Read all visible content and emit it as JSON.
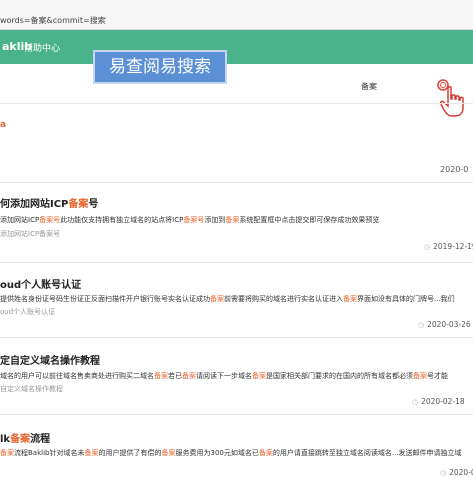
{
  "browser": {
    "url": "words=备案&commit=搜索"
  },
  "header": {
    "logo": "aklib",
    "help_label": "帮助中心"
  },
  "annotation": {
    "label": "易查阅易搜索"
  },
  "search": {
    "value": "备案"
  },
  "section_head": "a",
  "first_result_date": "2020-0",
  "results": [
    {
      "title_pre": "何添加网站ICP",
      "title_hl": "备案",
      "title_post": "号",
      "snippet_parts": [
        "添加网站ICP",
        "备案号",
        "此功能仅支持拥有独立域名的站点将ICP",
        "备案号",
        "添加到",
        "备案",
        "系统配置框中点击提交即可保存成功效果预览"
      ],
      "crumb": "添加网站ICP备案号",
      "date": "2019-12-19"
    },
    {
      "title_pre": "oud个人账号认证",
      "title_hl": "",
      "title_post": "",
      "snippet_parts": [
        "提供姓名身份证号码生份证正反面扫描件开户银行账号实名认证成功",
        "备案",
        "前需要将购买的域名进行实名认证进入",
        "备案",
        "界面如没有具体的门牌号...我们"
      ],
      "crumb": "oud个人账号认证",
      "date": "2020-03-26"
    },
    {
      "title_pre": "定自定义域名操作教程",
      "title_hl": "",
      "title_post": "",
      "snippet_parts": [
        "域名的用户可以前往域名售卖商处进行购买二域名",
        "备案",
        "若已",
        "备案",
        "请阅读下一步域名",
        "备案",
        "是国家相关部门要求的在国内的所有域名都必须",
        "备案",
        "号才能"
      ],
      "crumb": "自定义域名操作教程",
      "date": "2020-02-18"
    },
    {
      "title_pre": "lk",
      "title_hl": "备案",
      "title_post": "流程",
      "snippet_parts": [
        "备案",
        "流程Baklib针对域名未",
        "备案",
        "的用户提供了有偿的",
        "备案",
        "服务费用为300元如域名已",
        "备案",
        "的用户请直接跳转至独立域名阅读域名...发送邮件申请独立域"
      ],
      "crumb": "",
      "date": "2020-0"
    }
  ]
}
